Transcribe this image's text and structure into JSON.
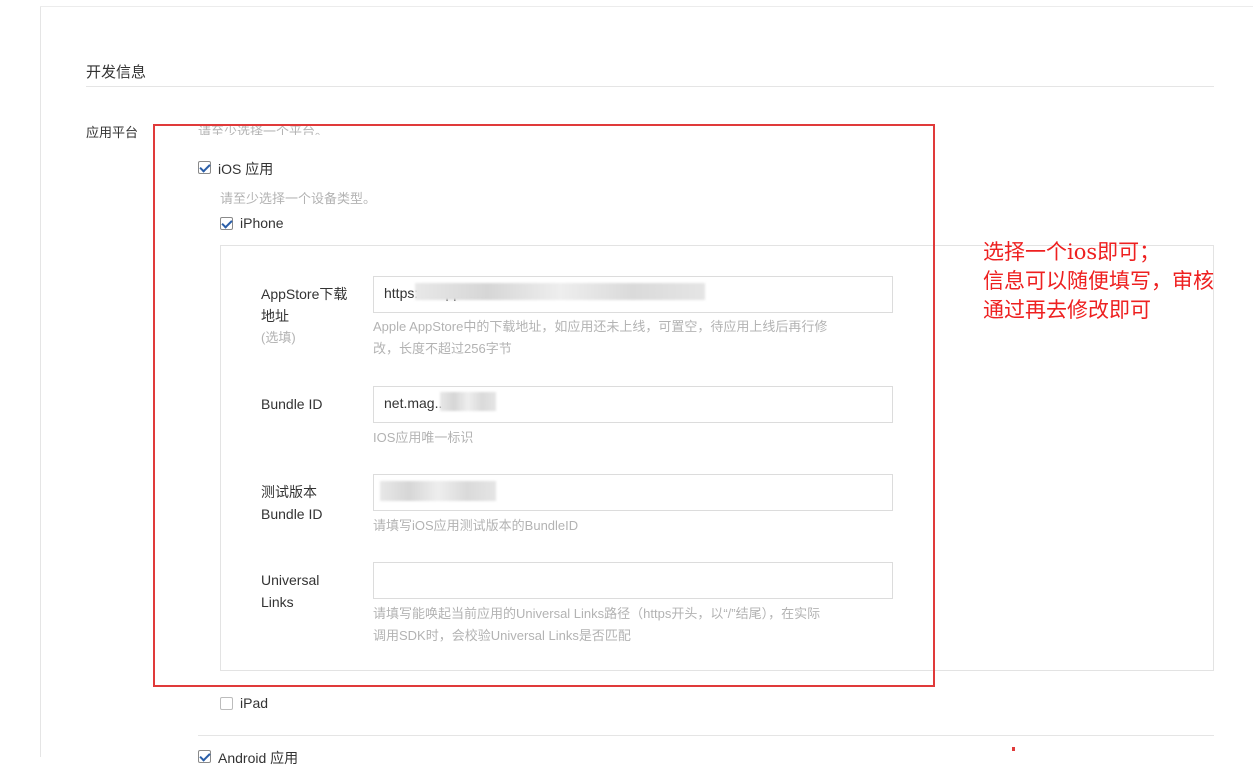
{
  "section": {
    "title": "开发信息"
  },
  "platform": {
    "label": "应用平台",
    "hint": "请至少选择一个平台。",
    "ios": {
      "label": "iOS 应用",
      "checked": true,
      "device_hint": "请至少选择一个设备类型。",
      "iphone": {
        "label": "iPhone",
        "checked": true,
        "fields": {
          "appstore": {
            "label_line1": "AppStore下载",
            "label_line2": "地址",
            "label_optional": "(选填)",
            "value": "https://...app/id...",
            "help_line1": "Apple AppStore中的下载地址，如应用还未上线，可置空，待应用上线后再行修",
            "help_line2": "改，长度不超过256字节"
          },
          "bundle_id": {
            "label": "Bundle ID",
            "value": "net.mag...",
            "help": "IOS应用唯一标识"
          },
          "test_bundle_id": {
            "label_line1": "测试版本",
            "label_line2": "Bundle ID",
            "value": "",
            "help": "请填写iOS应用测试版本的BundleID"
          },
          "universal_links": {
            "label_line1": "Universal",
            "label_line2": "Links",
            "value": "",
            "help_line1": "请填写能唤起当前应用的Universal Links路径（https开头，以“/”结尾），在实际",
            "help_line2": "调用SDK时，会校验Universal Links是否匹配"
          }
        }
      },
      "ipad": {
        "label": "iPad",
        "checked": false
      }
    },
    "android": {
      "label": "Android 应用",
      "checked": true
    }
  },
  "annotation": {
    "line1": "选择一个ios即可；",
    "line2": "信息可以随便填写，审核",
    "line3": "通过再去修改即可",
    "color": "#ee2020"
  },
  "colors": {
    "highlight_box": "#e03a3a",
    "check": "#2a5ea8",
    "hint_text": "#b3b3b3"
  }
}
